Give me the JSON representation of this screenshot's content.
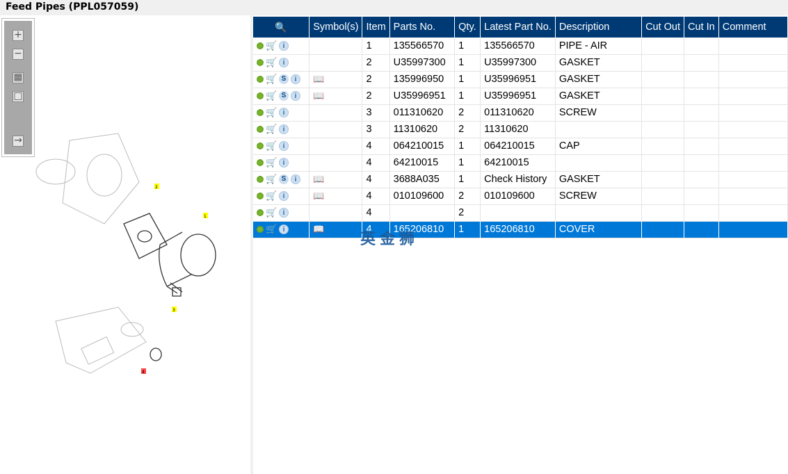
{
  "title": "Feed Pipes (PPL057059)",
  "toolbar": [
    "zoom-in",
    "zoom-out",
    "fit-all",
    "fit-window",
    "export"
  ],
  "callouts": [
    "1",
    "2",
    "3",
    "4"
  ],
  "columns": [
    "",
    "Symbol(s)",
    "Item",
    "Parts No.",
    "Qty.",
    "Latest Part No.",
    "Description",
    "Cut Out",
    "Cut In",
    "Comment"
  ],
  "rows": [
    {
      "s": false,
      "book": false,
      "item": "1",
      "part": "135566570",
      "qty": "1",
      "latest": "135566570",
      "desc": "PIPE - AIR"
    },
    {
      "s": false,
      "book": false,
      "item": "2",
      "part": "U35997300",
      "qty": "1",
      "latest": "U35997300",
      "desc": "GASKET"
    },
    {
      "s": true,
      "book": true,
      "item": "2",
      "part": "135996950",
      "qty": "1",
      "latest": "U35996951",
      "desc": "GASKET"
    },
    {
      "s": true,
      "book": true,
      "item": "2",
      "part": "U35996951",
      "qty": "1",
      "latest": "U35996951",
      "desc": "GASKET"
    },
    {
      "s": false,
      "book": false,
      "item": "3",
      "part": "011310620",
      "qty": "2",
      "latest": "011310620",
      "desc": "SCREW"
    },
    {
      "s": false,
      "book": false,
      "item": "3",
      "part": "11310620",
      "qty": "2",
      "latest": "11310620",
      "desc": ""
    },
    {
      "s": false,
      "book": false,
      "item": "4",
      "part": "064210015",
      "qty": "1",
      "latest": "064210015",
      "desc": "CAP"
    },
    {
      "s": false,
      "book": false,
      "item": "4",
      "part": "64210015",
      "qty": "1",
      "latest": "64210015",
      "desc": ""
    },
    {
      "s": true,
      "book": true,
      "item": "4",
      "part": "3688A035",
      "qty": "1",
      "latest": "Check History",
      "desc": "GASKET"
    },
    {
      "s": false,
      "book": true,
      "item": "4",
      "part": "010109600",
      "qty": "2",
      "latest": "010109600",
      "desc": "SCREW"
    },
    {
      "s": false,
      "book": false,
      "item": "4",
      "part": "",
      "qty": "2",
      "latest": "",
      "desc": ""
    },
    {
      "s": false,
      "book": true,
      "item": "4",
      "part": "165206810",
      "qty": "1",
      "latest": "165206810",
      "desc": "COVER",
      "selected": true
    }
  ],
  "watermark": "英金狮"
}
